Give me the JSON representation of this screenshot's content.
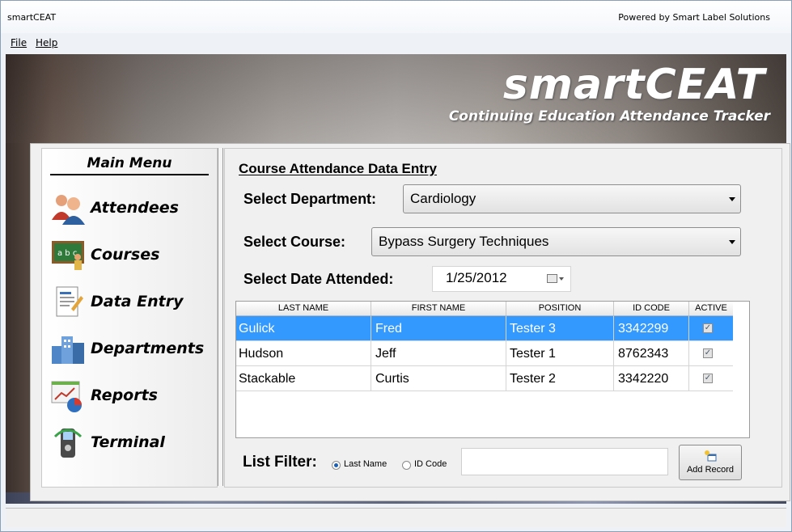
{
  "window": {
    "title": "smartCEAT",
    "powered_by": "Powered by Smart Label Solutions"
  },
  "menu": {
    "items": [
      {
        "label": "File"
      },
      {
        "label": "Help"
      }
    ]
  },
  "banner": {
    "logo": "smartCEAT",
    "tagline": "Continuing Education Attendance Tracker"
  },
  "main_menu": {
    "title": "Main Menu",
    "items": [
      {
        "label": "Attendees",
        "icon": "people-icon"
      },
      {
        "label": "Courses",
        "icon": "chalkboard-icon"
      },
      {
        "label": "Data Entry",
        "icon": "document-edit-icon"
      },
      {
        "label": "Departments",
        "icon": "buildings-icon"
      },
      {
        "label": "Reports",
        "icon": "chart-icon"
      },
      {
        "label": "Terminal",
        "icon": "handheld-terminal-icon"
      }
    ]
  },
  "form": {
    "title": "Course Attendance Data Entry",
    "department_label": "Select Department:",
    "department_value": "Cardiology",
    "course_label": "Select Course:",
    "course_value": "Bypass Surgery Techniques",
    "date_label": "Select Date Attended:",
    "date_value": "1/25/2012"
  },
  "grid": {
    "columns": [
      "LAST NAME",
      "FIRST NAME",
      "POSITION",
      "ID CODE",
      "ACTIVE"
    ],
    "rows": [
      {
        "last": "Gulick",
        "first": "Fred",
        "position": "Tester 3",
        "id": "3342299",
        "active": true,
        "selected": true
      },
      {
        "last": "Hudson",
        "first": "Jeff",
        "position": "Tester 1",
        "id": "8762343",
        "active": true,
        "selected": false
      },
      {
        "last": "Stackable",
        "first": "Curtis",
        "position": "Tester 2",
        "id": "3342220",
        "active": true,
        "selected": false
      }
    ]
  },
  "filter": {
    "label": "List Filter:",
    "options": [
      {
        "label": "Last Name",
        "checked": true
      },
      {
        "label": "ID Code",
        "checked": false
      }
    ],
    "value": ""
  },
  "add_button": {
    "label": "Add Record"
  },
  "colors": {
    "selection": "#3399ff",
    "accent": "#1b5fb5"
  }
}
